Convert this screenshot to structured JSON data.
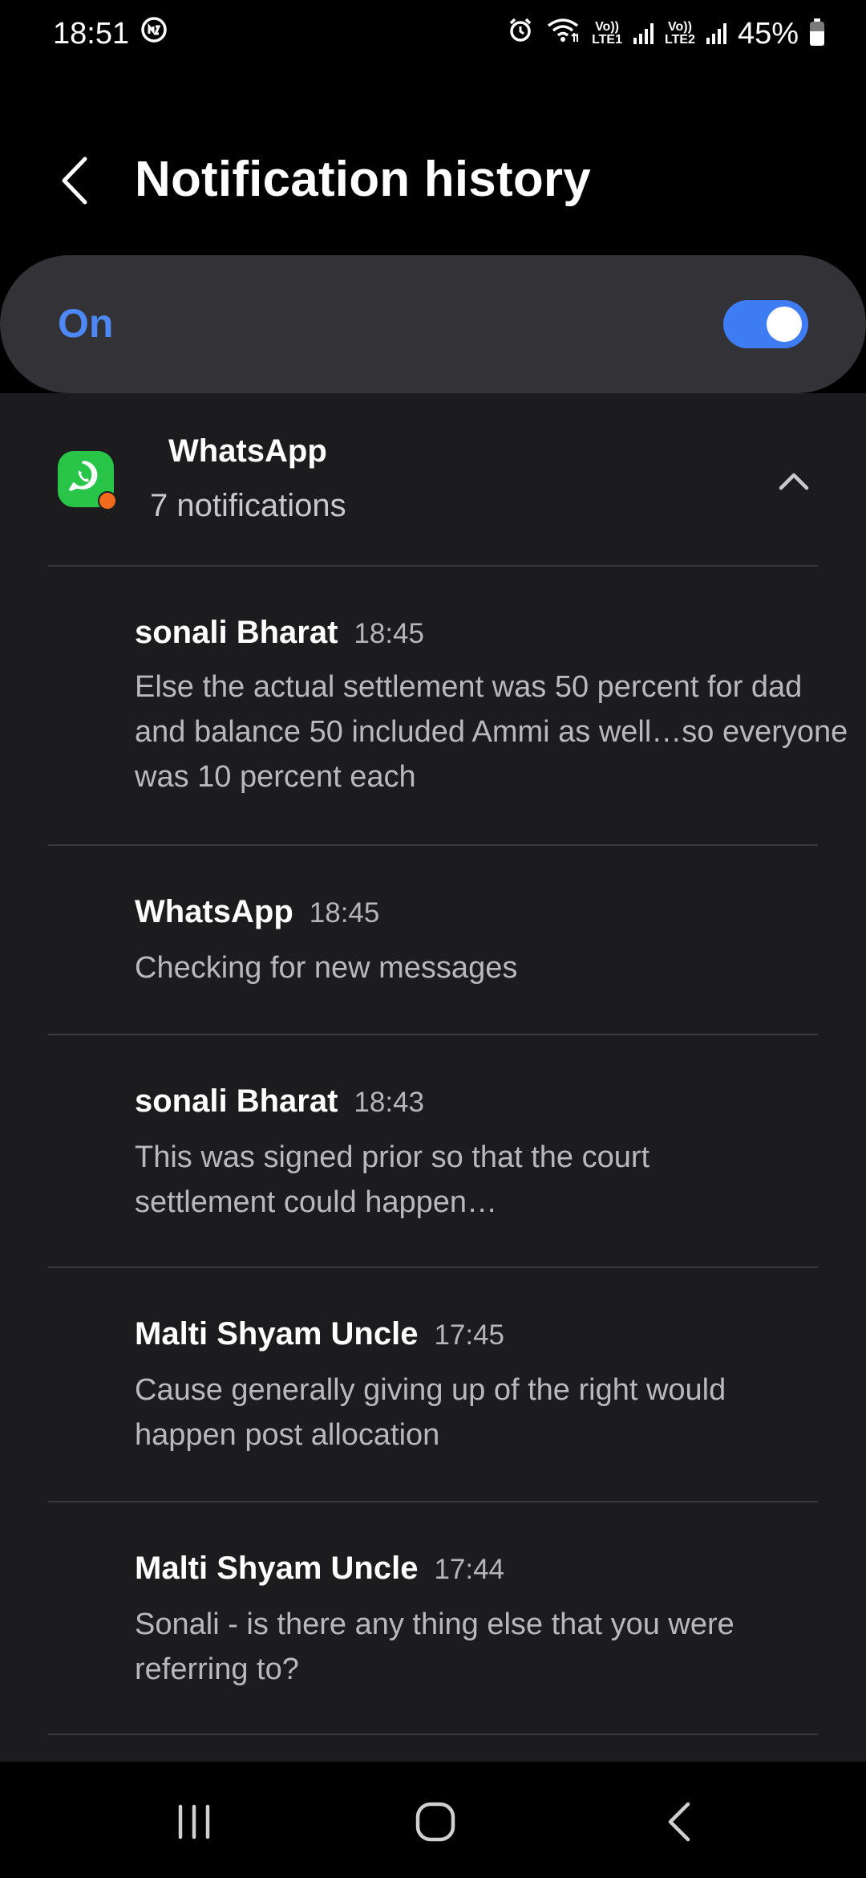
{
  "status_bar": {
    "time": "18:51",
    "lte1_top": "Vo))",
    "lte1_bottom": "LTE1",
    "lte2_top": "Vo))",
    "lte2_bottom": "LTE2",
    "battery_percent": "45%"
  },
  "header": {
    "title": "Notification history"
  },
  "master_toggle": {
    "label": "On",
    "enabled": true,
    "accent_color": "#3e7cf3"
  },
  "app_group": {
    "name": "WhatsApp",
    "count_label": "7 notifications",
    "icon": "whatsapp-icon",
    "icon_color": "#29c549"
  },
  "notifications": [
    {
      "sender": "sonali Bharat",
      "time": "18:45",
      "body": "Else the actual settlement was 50 percent for dad and balance 50 included Ammi as well…so everyone was 10 percent each"
    },
    {
      "sender": "WhatsApp",
      "time": "18:45",
      "body": "Checking for new messages"
    },
    {
      "sender": "sonali Bharat",
      "time": "18:43",
      "body": "This was signed prior so that the court settlement could happen…"
    },
    {
      "sender": "Malti Shyam Uncle",
      "time": "17:45",
      "body": "Cause generally giving up of the right would happen post allocation"
    },
    {
      "sender": "Malti Shyam Uncle",
      "time": "17:44",
      "body": "Sonali - is there any thing else that you were referring to?"
    }
  ],
  "nav_bar": {
    "recents": "recents-icon",
    "home": "home-icon",
    "back": "back-icon"
  }
}
